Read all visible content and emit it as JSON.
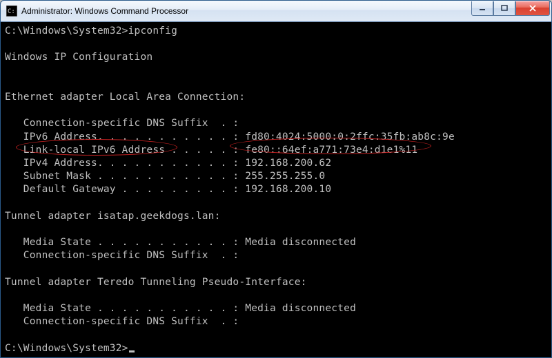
{
  "window": {
    "title": "Administrator: Windows Command Processor"
  },
  "term": {
    "prompt1": "C:\\Windows\\System32>ipconfig",
    "blank": "",
    "header": "Windows IP Configuration",
    "eth_hdr": "Ethernet adapter Local Area Connection:",
    "eth": {
      "dns": "   Connection-specific DNS Suffix  . :",
      "ipv6": "   IPv6 Address. . . . . . . . . . . : fd80:4024:5000:0:2ffc:35fb:ab8c:9e",
      "ll_lbl": "   Link-local IPv6 Address . . . . . : ",
      "ll_val": "fe80::64ef:a771:73e4:d1e1%11",
      "ipv4": "   IPv4 Address. . . . . . . . . . . : 192.168.200.62",
      "mask": "   Subnet Mask . . . . . . . . . . . : 255.255.255.0",
      "gw": "   Default Gateway . . . . . . . . . : 192.168.200.10"
    },
    "isatap_hdr": "Tunnel adapter isatap.geekdogs.lan:",
    "isatap": {
      "media": "   Media State . . . . . . . . . . . : Media disconnected",
      "dns": "   Connection-specific DNS Suffix  . :"
    },
    "teredo_hdr": "Tunnel adapter Teredo Tunneling Pseudo-Interface:",
    "teredo": {
      "media": "   Media State . . . . . . . . . . . : Media disconnected",
      "dns": "   Connection-specific DNS Suffix  . :"
    },
    "prompt2": "C:\\Windows\\System32>"
  }
}
